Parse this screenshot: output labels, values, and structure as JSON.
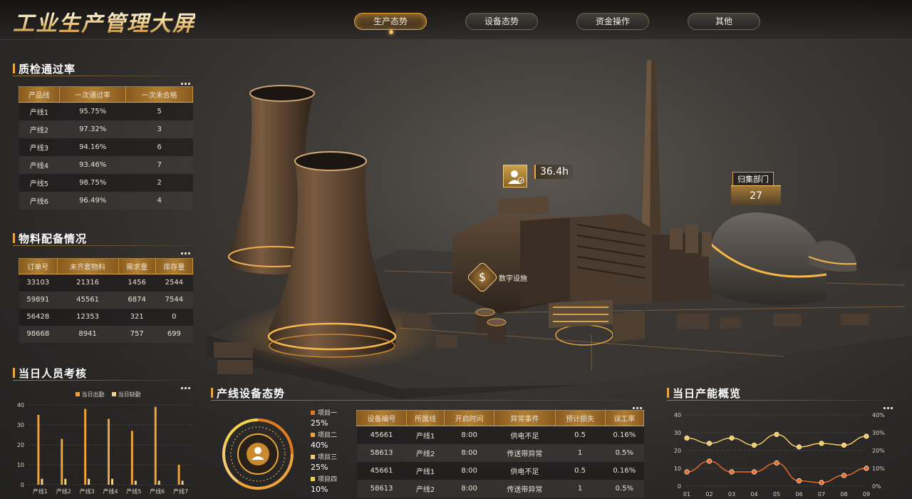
{
  "header": {
    "title": "工业生产管理大屏",
    "tabs": [
      {
        "label": "生产态势",
        "active": true
      },
      {
        "label": "设备态势",
        "active": false
      },
      {
        "label": "资金操作",
        "active": false
      },
      {
        "label": "其他",
        "active": false
      }
    ]
  },
  "quality": {
    "title": "质检通过率",
    "columns": [
      "产品线",
      "一次通过率",
      "一次未合格"
    ],
    "rows": [
      [
        "产线1",
        "95.75%",
        "5"
      ],
      [
        "产线2",
        "97.32%",
        "3"
      ],
      [
        "产线3",
        "94.16%",
        "6"
      ],
      [
        "产线4",
        "93.46%",
        "7"
      ],
      [
        "产线5",
        "98.75%",
        "2"
      ],
      [
        "产线6",
        "96.49%",
        "4"
      ]
    ]
  },
  "materials": {
    "title": "物料配备情况",
    "columns": [
      "订单号",
      "未齐套物料",
      "需求量",
      "库存量"
    ],
    "rows": [
      [
        "33103",
        "21316",
        "1456",
        "2544"
      ],
      [
        "59891",
        "45561",
        "6874",
        "7544"
      ],
      [
        "56428",
        "12353",
        "321",
        "0"
      ],
      [
        "98668",
        "8941",
        "757",
        "699"
      ]
    ]
  },
  "staff": {
    "title": "当日人员考核",
    "legend": [
      "当日出勤",
      "当日缺勤"
    ]
  },
  "equipment": {
    "title": "产线设备态势",
    "legend": [
      {
        "label": "项目一",
        "value": "25%",
        "color": "#e07a1e"
      },
      {
        "label": "项目二",
        "value": "40%",
        "color": "#f0a23a"
      },
      {
        "label": "项目三",
        "value": "25%",
        "color": "#f6c873"
      },
      {
        "label": "项目四",
        "value": "10%",
        "color": "#f2d04a"
      }
    ],
    "columns": [
      "设备编号",
      "所属线",
      "开启时间",
      "异常事件",
      "预计损失",
      "误工率"
    ],
    "rows": [
      [
        "45661",
        "产线1",
        "8:00",
        "供电不足",
        "0.5",
        "0.16%"
      ],
      [
        "58613",
        "产线2",
        "8:00",
        "传送带异常",
        "1",
        "0.5%"
      ],
      [
        "45661",
        "产线1",
        "8:00",
        "供电不足",
        "0.5",
        "0.16%"
      ],
      [
        "58613",
        "产线2",
        "8:00",
        "传送带异常",
        "1",
        "0.5%"
      ]
    ]
  },
  "capacity": {
    "title": "当日产能概览"
  },
  "map": {
    "value_label": "36.4h",
    "dept_label": "归集部门",
    "dept_value": "27",
    "digital_label": "数字设施"
  },
  "chart_data": [
    {
      "type": "bar",
      "categories": [
        "产线1",
        "产线2",
        "产线3",
        "产线4",
        "产线5",
        "产线6",
        "产线7"
      ],
      "series": [
        {
          "name": "当日出勤",
          "values": [
            35,
            23,
            38,
            33,
            27,
            39,
            10
          ],
          "color": "#f0a23a"
        },
        {
          "name": "当日缺勤",
          "values": [
            3,
            3,
            3,
            3,
            2,
            2,
            2
          ],
          "color": "#f3d28a"
        }
      ],
      "ylim": [
        0,
        40
      ],
      "yticks": [
        0,
        10,
        20,
        30,
        40
      ],
      "legend": "top-center"
    },
    {
      "type": "line",
      "x": [
        "01",
        "02",
        "03",
        "04",
        "05",
        "06",
        "07",
        "08",
        "09"
      ],
      "yticks_left": [
        0,
        10,
        20,
        30,
        40
      ],
      "yticks_right": [
        "0%",
        "10%",
        "20%",
        "30%",
        "40%"
      ],
      "ylim": [
        0,
        40
      ],
      "series": [
        {
          "values": [
            27,
            24,
            27,
            23,
            29,
            22,
            24,
            23,
            28
          ],
          "color": "#f5c860"
        },
        {
          "values": [
            8,
            14,
            8,
            8,
            13,
            3,
            2,
            6,
            10
          ],
          "color": "#e9682a"
        }
      ]
    }
  ]
}
